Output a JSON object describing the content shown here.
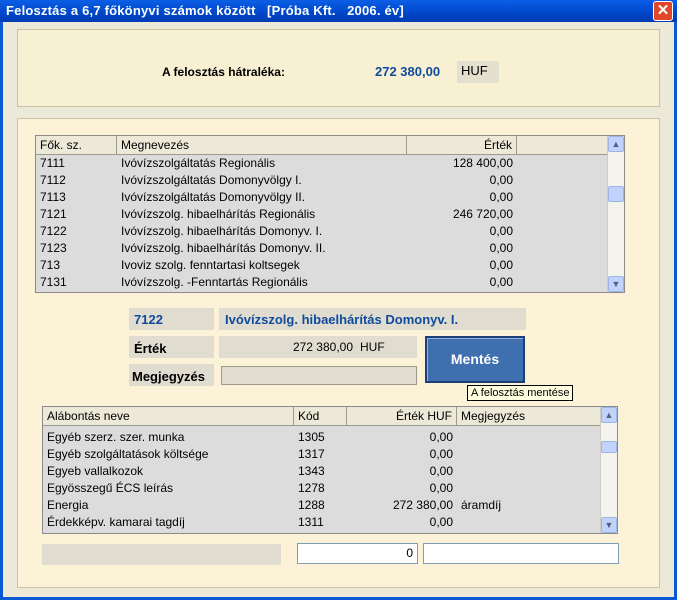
{
  "window": {
    "title": "Felosztás a 6,7 főkönyvi számok között   [Próba Kft.   2006. év]",
    "close_glyph": "✕"
  },
  "summary": {
    "label": "A felosztás hátraléka:",
    "amount": "272 380,00",
    "currency": "HUF"
  },
  "accounts_table": {
    "columns": [
      "Fők. sz.",
      "Megnevezés",
      "Érték",
      ""
    ],
    "rows": [
      {
        "code": "7111",
        "name": "Ivóvízszolgáltatás   Regionális",
        "value": "128 400,00"
      },
      {
        "code": "7112",
        "name": "Ivóvízszolgáltatás   Domonyvölgy I.",
        "value": "0,00"
      },
      {
        "code": "7113",
        "name": "Ivóvízszolgáltatás   Domonyvölgy II.",
        "value": "0,00"
      },
      {
        "code": "7121",
        "name": "Ivóvízszolg. hibaelhárítás  Regionális",
        "value": "246 720,00"
      },
      {
        "code": "7122",
        "name": "Ivóvízszolg. hibaelhárítás  Domonyv. I.",
        "value": "0,00"
      },
      {
        "code": "7123",
        "name": "Ivóvízszolg. hibaelhárítás  Domonyv. II.",
        "value": "0,00"
      },
      {
        "code": "713",
        "name": "Ivoviz szolg. fenntartasi koltsegek",
        "value": "0,00"
      },
      {
        "code": "7131",
        "name": "Ivóvízszolg. -Fenntartás  Regionális",
        "value": "0,00"
      }
    ]
  },
  "selected": {
    "code": "7122",
    "name": "Ivóvízszolg. hibaelhárítás  Domonyv. I.",
    "value_label": "Érték",
    "value": "272 380,00",
    "currency": "HUF",
    "note_label": "Megjegyzés",
    "note_value": ""
  },
  "save_button": {
    "label": "Mentés",
    "tooltip": "A felosztás mentése"
  },
  "breakdown_table": {
    "columns": [
      "Alábontás neve",
      "Kód",
      "Érték HUF",
      "Megjegyzés"
    ],
    "rows": [
      {
        "name": "Egyéb szerz. szer. munka",
        "code": "1305",
        "value": "0,00",
        "note": ""
      },
      {
        "name": "Egyéb szolgáltatások költsége",
        "code": "1317",
        "value": "0,00",
        "note": ""
      },
      {
        "name": "Egyeb vallalkozok",
        "code": "1343",
        "value": "0,00",
        "note": ""
      },
      {
        "name": "Egyösszegű ÉCS leírás",
        "code": "1278",
        "value": "0,00",
        "note": ""
      },
      {
        "name": "Energia",
        "code": "1288",
        "value": "272 380,00",
        "note": "áramdíj"
      },
      {
        "name": "Érdekképv. kamarai tagdíj",
        "code": "1311",
        "value": "0,00",
        "note": ""
      }
    ]
  },
  "footer": {
    "total_value": "0",
    "total_note": ""
  }
}
